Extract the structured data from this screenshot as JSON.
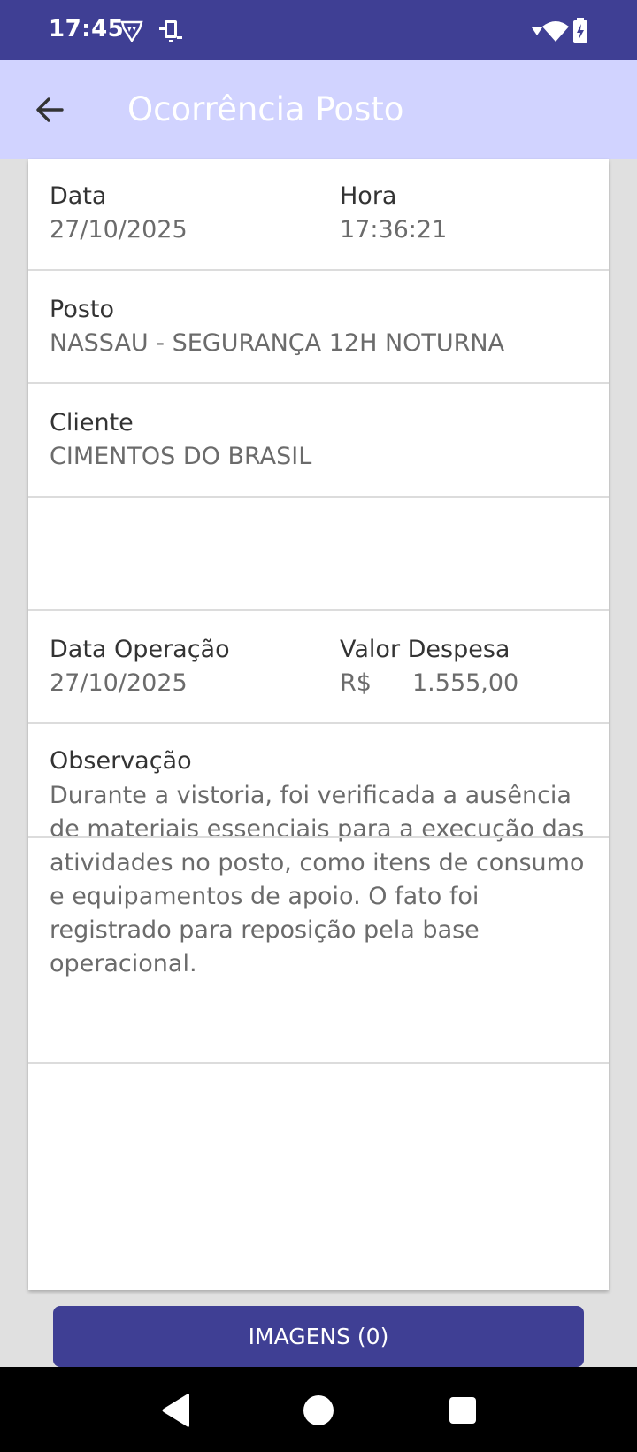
{
  "status_bar": {
    "time": "17:45",
    "icons": [
      "vpn-shield-icon",
      "device-icon",
      "signal-icon",
      "wifi-icon",
      "battery-charging-icon"
    ]
  },
  "app_bar": {
    "title": "Ocorrência Posto",
    "back_icon": "arrow-left-icon"
  },
  "details": {
    "date": {
      "label": "Data",
      "value": "27/10/2025"
    },
    "time": {
      "label": "Hora",
      "value": "17:36:21"
    },
    "post": {
      "label": "Posto",
      "value": "NASSAU - SEGURANÇA 12H NOTURNA"
    },
    "client": {
      "label": "Cliente",
      "value": "CIMENTOS DO BRASIL"
    },
    "operation_date": {
      "label": "Data Operação",
      "value": "27/10/2025"
    },
    "expense": {
      "label": "Valor Despesa",
      "currency": "R$",
      "value": "1.555,00"
    },
    "observation": {
      "label": "Observação",
      "value": "Durante a vistoria, foi verificada a ausência de materiais essenciais para a execução das atividades no posto, como itens de consumo e equipamentos de apoio. O fato foi registrado para reposição pela base operacional."
    }
  },
  "actions": {
    "images_button": "IMAGENS (0)"
  },
  "nav_bar": {
    "icons": [
      "back-triangle-icon",
      "home-circle-icon",
      "recents-square-icon"
    ]
  },
  "colors": {
    "primary": "#3f3f94",
    "app_bar": "#d1d3ff",
    "background": "#e0e0e0"
  }
}
